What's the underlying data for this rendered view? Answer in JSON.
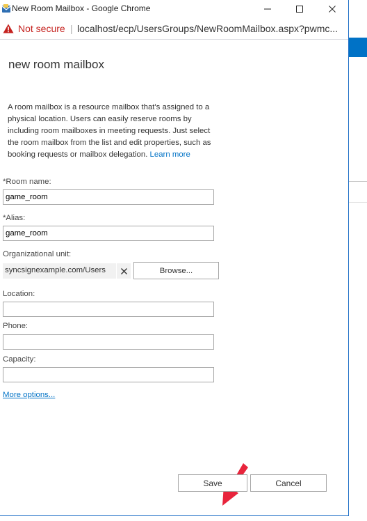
{
  "browser": {
    "window_title": "New Room Mailbox - Google Chrome",
    "security_label": "Not secure",
    "separator": "|",
    "url": "localhost/ecp/UsersGroups/NewRoomMailbox.aspx?pwmc..."
  },
  "page": {
    "title": "new room mailbox",
    "description": "A room mailbox is a resource mailbox that's assigned to a physical location. Users can easily reserve rooms by including room mailboxes in meeting requests. Just select the room mailbox from the list and edit properties, such as booking requests or mailbox delegation.",
    "learn_more": "Learn more"
  },
  "form": {
    "room_name": {
      "label": "*Room name:",
      "value": "game_room"
    },
    "alias": {
      "label": "*Alias:",
      "value": "game_room"
    },
    "org_unit": {
      "label": "Organizational unit:",
      "value": "syncsignexample.com/Users",
      "browse_label": "Browse..."
    },
    "location": {
      "label": "Location:",
      "value": ""
    },
    "phone": {
      "label": "Phone:",
      "value": ""
    },
    "capacity": {
      "label": "Capacity:",
      "value": ""
    },
    "more_options": "More options..."
  },
  "footer": {
    "save_label": "Save",
    "cancel_label": "Cancel"
  },
  "icons": {
    "app": "mailbox-app-icon",
    "warning": "warning-triangle-icon",
    "clear": "close-x-icon",
    "annotation": "red-arrow-icon"
  },
  "colors": {
    "link": "#0072c6",
    "warning": "#c5221f",
    "arrow": "#e8243c",
    "window_border": "#1f6fc6"
  }
}
